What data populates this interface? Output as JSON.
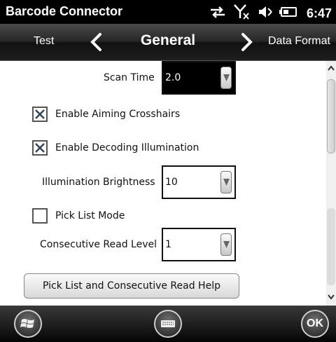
{
  "statusbar": {
    "app_title": "Barcode Connector",
    "time": "6:47",
    "icons": [
      "sync-arrows-icon",
      "no-signal-icon",
      "volume-mute-icon",
      "battery-icon"
    ]
  },
  "tabs": {
    "previous": "Test",
    "current": "General",
    "next": "Data Format"
  },
  "form": {
    "scan_time": {
      "label": "Scan Time",
      "value": "2.0"
    },
    "aiming": {
      "label": "Enable Aiming Crosshairs",
      "checked": true
    },
    "decoding": {
      "label": "Enable Decoding Illumination",
      "checked": true
    },
    "brightness": {
      "label": "Illumination Brightness",
      "value": "10"
    },
    "pick_list": {
      "label": "Pick List Mode",
      "checked": false
    },
    "consecutive": {
      "label": "Consecutive Read Level",
      "value": "1"
    },
    "help_button": "Pick List and Consecutive Read Help"
  },
  "softkeys": {
    "start": "windows-start-icon",
    "keyboard": "keyboard-icon",
    "ok": "OK"
  }
}
